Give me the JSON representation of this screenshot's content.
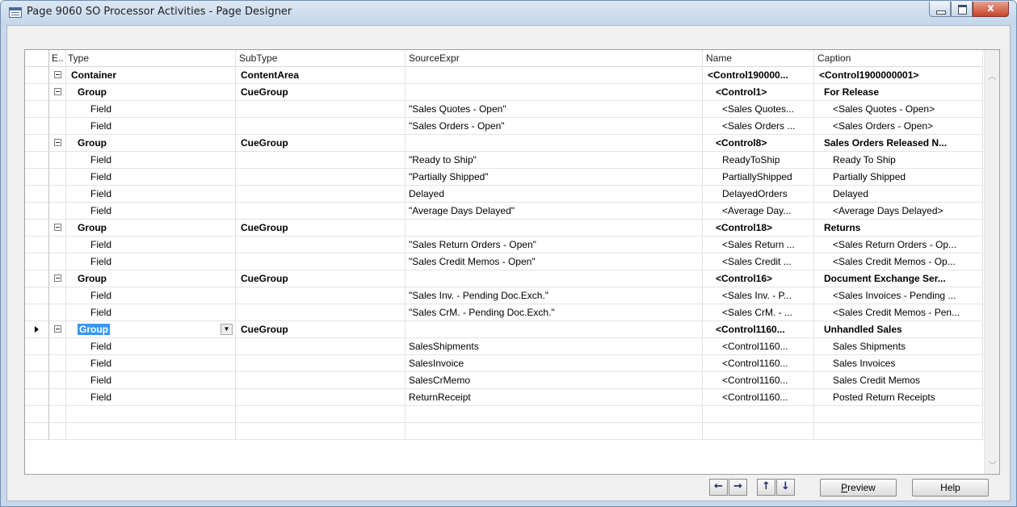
{
  "window": {
    "title": "Page 9060 SO Processor Activities - Page Designer",
    "controls": {
      "minimize": "minimize",
      "maximize": "maximize",
      "close": "x"
    }
  },
  "grid": {
    "headers": {
      "expand": "E..",
      "type": "Type",
      "subtype": "SubType",
      "source": "SourceExpr",
      "name": "Name",
      "caption": "Caption"
    },
    "rows": [
      {
        "kind": "container",
        "type": "Container",
        "subtype": "ContentArea",
        "source": "",
        "name": "<Control190000...",
        "caption": "<Control1900000001>"
      },
      {
        "kind": "group",
        "type": "Group",
        "subtype": "CueGroup",
        "source": "",
        "name": "<Control1>",
        "caption": "For Release"
      },
      {
        "kind": "field",
        "type": "Field",
        "subtype": "",
        "source": "\"Sales Quotes - Open\"",
        "name": "<Sales Quotes...",
        "caption": "<Sales Quotes - Open>"
      },
      {
        "kind": "field",
        "type": "Field",
        "subtype": "",
        "source": "\"Sales Orders - Open\"",
        "name": "<Sales Orders ...",
        "caption": "<Sales Orders - Open>"
      },
      {
        "kind": "group",
        "type": "Group",
        "subtype": "CueGroup",
        "source": "",
        "name": "<Control8>",
        "caption": "Sales Orders Released N..."
      },
      {
        "kind": "field",
        "type": "Field",
        "subtype": "",
        "source": "\"Ready to Ship\"",
        "name": "ReadyToShip",
        "caption": "Ready To Ship"
      },
      {
        "kind": "field",
        "type": "Field",
        "subtype": "",
        "source": "\"Partially Shipped\"",
        "name": "PartiallyShipped",
        "caption": "Partially Shipped"
      },
      {
        "kind": "field",
        "type": "Field",
        "subtype": "",
        "source": "Delayed",
        "name": "DelayedOrders",
        "caption": "Delayed"
      },
      {
        "kind": "field",
        "type": "Field",
        "subtype": "",
        "source": "\"Average Days Delayed\"",
        "name": "<Average Day...",
        "caption": "<Average Days Delayed>"
      },
      {
        "kind": "group",
        "type": "Group",
        "subtype": "CueGroup",
        "source": "",
        "name": "<Control18>",
        "caption": "Returns"
      },
      {
        "kind": "field",
        "type": "Field",
        "subtype": "",
        "source": "\"Sales Return Orders - Open\"",
        "name": "<Sales Return ...",
        "caption": "<Sales Return Orders - Op..."
      },
      {
        "kind": "field",
        "type": "Field",
        "subtype": "",
        "source": "\"Sales Credit Memos - Open\"",
        "name": "<Sales Credit ...",
        "caption": "<Sales Credit Memos - Op..."
      },
      {
        "kind": "group",
        "type": "Group",
        "subtype": "CueGroup",
        "source": "",
        "name": "<Control16>",
        "caption": "Document Exchange Ser..."
      },
      {
        "kind": "field",
        "type": "Field",
        "subtype": "",
        "source": "\"Sales Inv. - Pending Doc.Exch.\"",
        "name": "<Sales Inv. - P...",
        "caption": "<Sales Invoices - Pending ..."
      },
      {
        "kind": "field",
        "type": "Field",
        "subtype": "",
        "source": "\"Sales CrM. - Pending Doc.Exch.\"",
        "name": "<Sales CrM. - ...",
        "caption": "<Sales Credit Memos - Pen..."
      },
      {
        "kind": "group-current",
        "type": "Group",
        "subtype": "CueGroup",
        "source": "",
        "name": "<Control1160...",
        "caption": "Unhandled Sales"
      },
      {
        "kind": "field",
        "type": "Field",
        "subtype": "",
        "source": "SalesShipments",
        "name": "<Control1160...",
        "caption": "Sales Shipments"
      },
      {
        "kind": "field",
        "type": "Field",
        "subtype": "",
        "source": "SalesInvoice",
        "name": "<Control1160...",
        "caption": "Sales Invoices"
      },
      {
        "kind": "field",
        "type": "Field",
        "subtype": "",
        "source": "SalesCrMemo",
        "name": "<Control1160...",
        "caption": "Sales Credit Memos"
      },
      {
        "kind": "field",
        "type": "Field",
        "subtype": "",
        "source": "ReturnReceipt",
        "name": "<Control1160...",
        "caption": "Posted Return Receipts"
      },
      {
        "kind": "empty",
        "type": "",
        "subtype": "",
        "source": "",
        "name": "",
        "caption": ""
      },
      {
        "kind": "empty",
        "type": "",
        "subtype": "",
        "source": "",
        "name": "",
        "caption": ""
      }
    ]
  },
  "footer": {
    "nav_left": "←",
    "nav_right": "→",
    "nav_up": "↑",
    "nav_down": "↓",
    "preview_first": "P",
    "preview_rest": "review",
    "help": "Help"
  },
  "colors": {
    "selection": "#3399ff",
    "chrome": "#c9d9ec",
    "close": "#c8452a"
  }
}
